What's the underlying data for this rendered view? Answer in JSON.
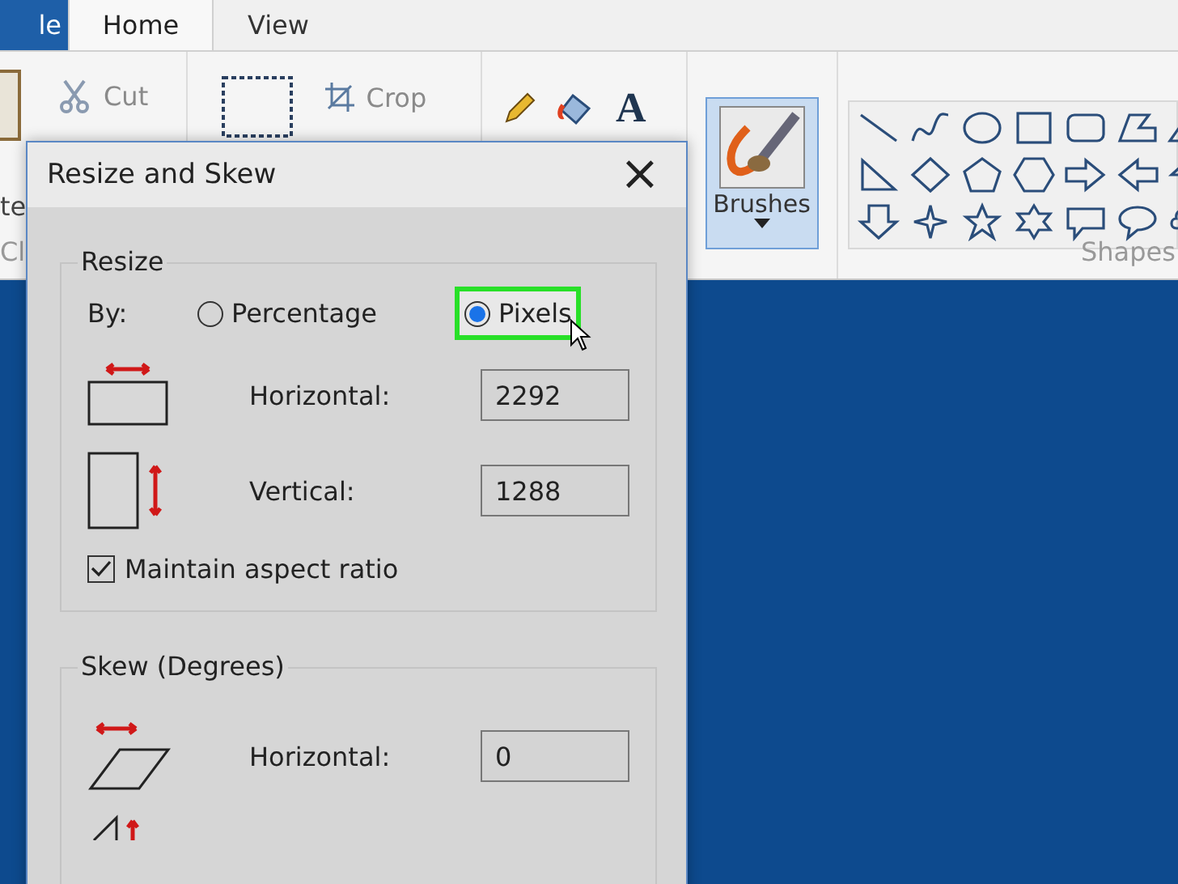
{
  "ribbon": {
    "tabs": [
      {
        "label": "le",
        "kind": "file",
        "selected": false
      },
      {
        "label": "Home",
        "kind": "tab",
        "selected": true
      },
      {
        "label": "View",
        "kind": "tab",
        "selected": false
      }
    ],
    "clipboard": {
      "cut": "Cut",
      "paste_label": "te",
      "group_label": "Cl"
    },
    "image": {
      "crop": "Crop"
    },
    "tools": {
      "text_glyph": "A"
    },
    "brushes": {
      "label": "Brushes",
      "selected": true
    },
    "shapes": {
      "group_label": "Shapes"
    }
  },
  "dialog": {
    "title": "Resize and Skew",
    "close": "×",
    "resize": {
      "legend": "Resize",
      "by_label": "By:",
      "options": [
        {
          "label": "Percentage",
          "selected": false,
          "highlighted": false
        },
        {
          "label": "Pixels",
          "selected": true,
          "highlighted": true
        }
      ],
      "fields": [
        {
          "kind": "horizontal",
          "label": "Horizontal:",
          "value": "2292"
        },
        {
          "kind": "vertical",
          "label": "Vertical:",
          "value": "1288"
        }
      ],
      "aspect": {
        "label": "Maintain aspect ratio",
        "checked": true
      }
    },
    "skew": {
      "legend": "Skew (Degrees)",
      "fields": [
        {
          "kind": "horizontal",
          "label": "Horizontal:",
          "value": "0"
        }
      ]
    }
  }
}
